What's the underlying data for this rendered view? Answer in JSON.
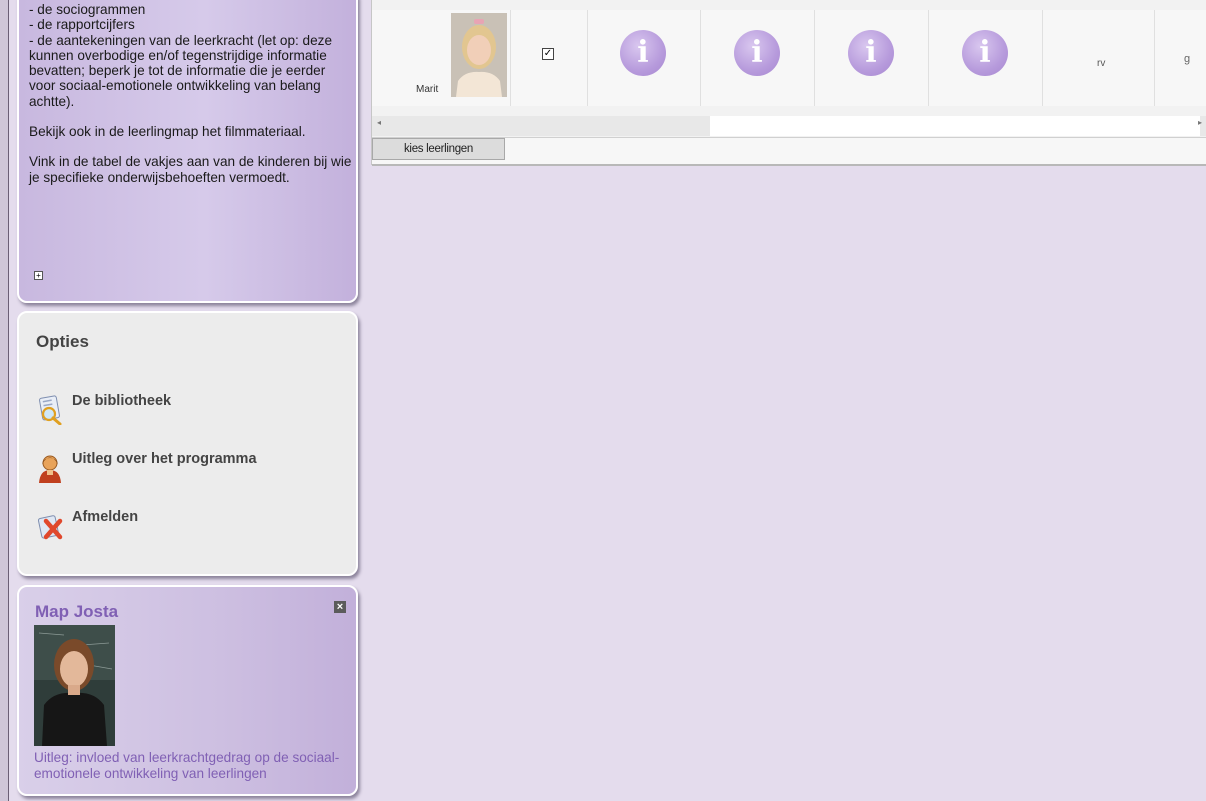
{
  "instructions": {
    "lines": [
      "- de sociogrammen",
      "- de rapportcijfers",
      "- de aantekeningen van de leerkracht (let op: deze kunnen overbodige en/of tegenstrijdige informatie bevatten; beperk je tot de informatie die je eerder voor sociaal-emotionele ontwikkeling van belang achtte)."
    ],
    "paragraph2": "Bekijk ook in de leerlingmap het filmmateriaal.",
    "paragraph3": "Vink in de tabel de vakjes aan van de kinderen bij wie je specifieke onderwijsbehoeften vermoedt.",
    "expand_symbol": "+"
  },
  "opties": {
    "title": "Opties",
    "items": [
      {
        "label": "De bibliotheek",
        "icon": "library-search-icon"
      },
      {
        "label": "Uitleg over het programma",
        "icon": "user-help-icon"
      },
      {
        "label": "Afmelden",
        "icon": "logout-icon"
      }
    ]
  },
  "map": {
    "title": "Map Josta",
    "close_symbol": "×",
    "caption": "Uitleg: invloed van leerkrachtgedrag op de sociaal-emotionele ontwikkeling van leerlingen"
  },
  "table": {
    "student": {
      "name": "Marit",
      "checked": true,
      "check_symbol": "✓"
    },
    "info_glyph": "i",
    "col_rv": "rv",
    "col_g": "g",
    "scroll_left": "◂",
    "scroll_right": "▸",
    "button_label": "kies leerlingen"
  },
  "colors": {
    "accent": "#8060b4",
    "page_bg": "#e4dced"
  }
}
